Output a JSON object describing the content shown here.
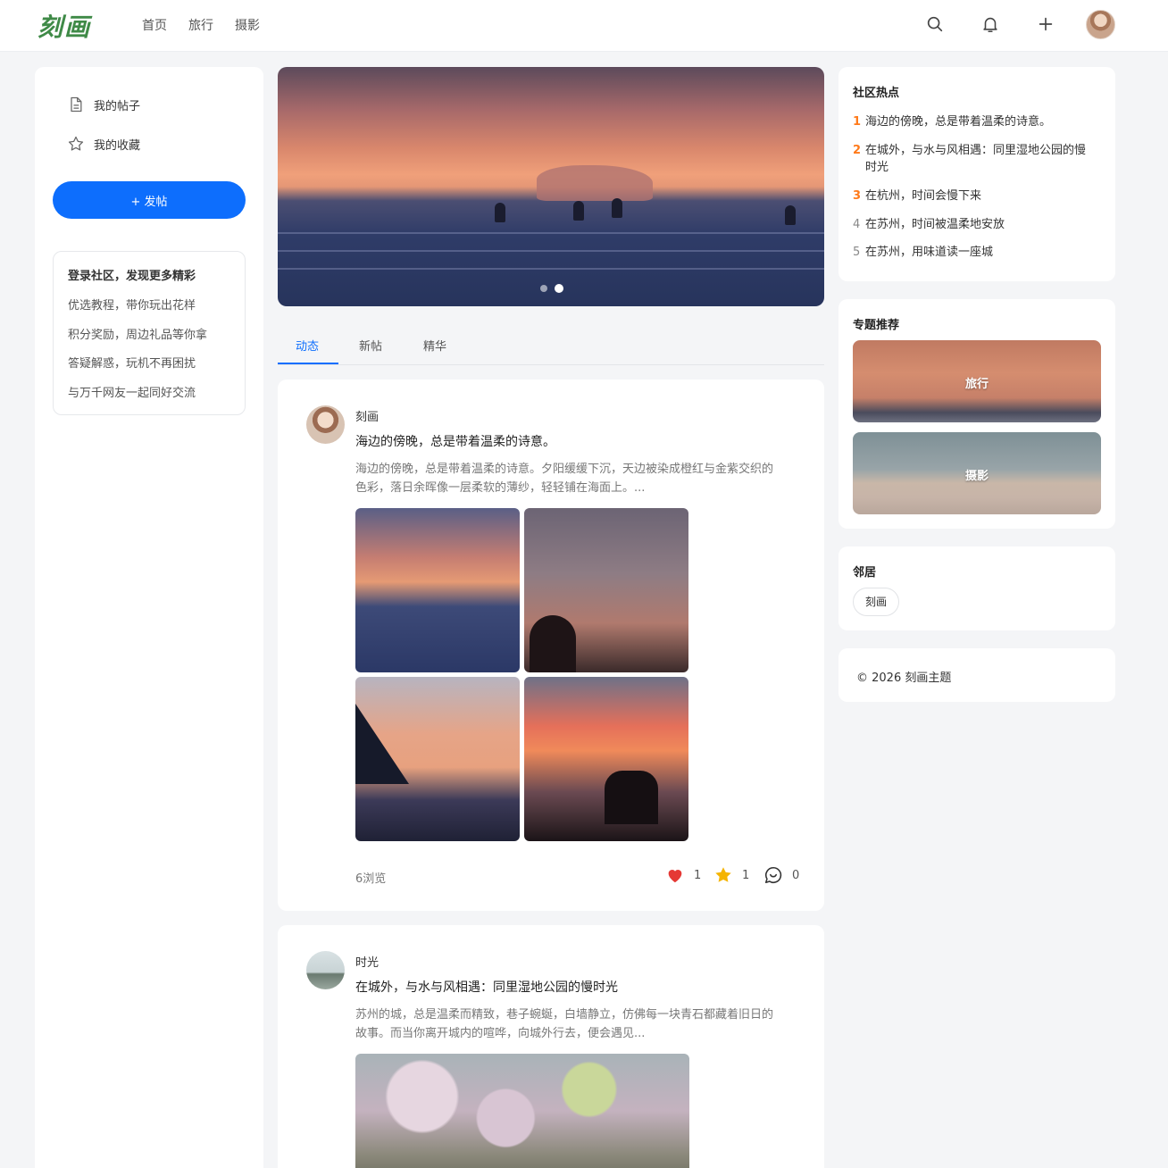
{
  "header": {
    "logo": "刻画",
    "nav": [
      "首页",
      "旅行",
      "摄影"
    ],
    "icons": [
      "search-icon",
      "bell-icon",
      "plus-icon",
      "avatar"
    ]
  },
  "sidebar": {
    "items": [
      {
        "label": "我的帖子",
        "icon": "document-icon"
      },
      {
        "label": "我的收藏",
        "icon": "star-icon"
      }
    ],
    "post_button": "+ 发帖",
    "login_box": {
      "title": "登录社区，发现更多精彩",
      "lines": [
        "优选教程，带你玩出花样",
        "积分奖励，周边礼品等你拿",
        "答疑解惑，玩机不再困扰",
        "与万千网友一起同好交流"
      ]
    }
  },
  "tabs": [
    "动态",
    "新帖",
    "精华"
  ],
  "posts": [
    {
      "author": "刻画",
      "title": "海边的傍晚，总是带着温柔的诗意。",
      "excerpt": "海边的傍晚，总是带着温柔的诗意。夕阳缓缓下沉，天边被染成橙红与金紫交织的色彩，落日余晖像一层柔软的薄纱，轻轻铺在海面上。...",
      "views": "6浏览",
      "likes": "1",
      "favorites": "1",
      "comments": "0"
    },
    {
      "author": "时光",
      "title": "在城外，与水与风相遇：同里湿地公园的慢时光",
      "excerpt": "苏州的城，总是温柔而精致，巷子蜿蜒，白墙静立，仿佛每一块青石都藏着旧日的故事。而当你离开城内的喧哗，向城外行去，便会遇见..."
    }
  ],
  "right": {
    "hot": {
      "title": "社区热点",
      "items": [
        {
          "num": "1",
          "text": "海边的傍晚，总是带着温柔的诗意。"
        },
        {
          "num": "2",
          "text": "在城外，与水与风相遇：同里湿地公园的慢时光"
        },
        {
          "num": "3",
          "text": "在杭州，时间会慢下来"
        },
        {
          "num": "4",
          "text": "在苏州，时间被温柔地安放"
        },
        {
          "num": "5",
          "text": "在苏州，用味道读一座城"
        }
      ]
    },
    "topics": {
      "title": "专题推荐",
      "items": [
        "旅行",
        "摄影"
      ]
    },
    "neighbors": {
      "title": "邻居",
      "items": [
        "刻画"
      ]
    },
    "copyright": "© 2026 刻画主题"
  },
  "colors": {
    "accent": "#0d6efd",
    "logo": "#3f8a47",
    "hot_rank": "#ff7a1a",
    "like": "#e53935",
    "favorite": "#f5b400"
  }
}
